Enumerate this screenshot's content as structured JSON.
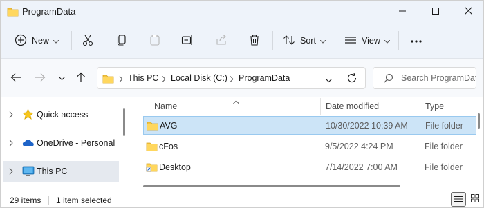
{
  "window": {
    "title": "ProgramData"
  },
  "toolbar": {
    "new_label": "New",
    "sort_label": "Sort",
    "view_label": "View",
    "more_label": "···"
  },
  "address": {
    "crumbs": [
      "This PC",
      "Local Disk (C:)",
      "ProgramData"
    ]
  },
  "search": {
    "placeholder": "Search ProgramData"
  },
  "nav": {
    "items": [
      {
        "label": "Quick access",
        "icon": "star-icon"
      },
      {
        "label": "OneDrive - Personal",
        "icon": "cloud-icon"
      },
      {
        "label": "This PC",
        "icon": "monitor-icon",
        "selected": true
      }
    ]
  },
  "columns": {
    "name": "Name",
    "date": "Date modified",
    "type": "Type"
  },
  "files": [
    {
      "name": "AVG",
      "date": "10/30/2022 10:39 AM",
      "type": "File folder",
      "selected": true
    },
    {
      "name": "cFos",
      "date": "9/5/2022 4:24 PM",
      "type": "File folder"
    },
    {
      "name": "Desktop",
      "date": "7/14/2022 7:00 AM",
      "type": "File folder"
    }
  ],
  "status": {
    "item_count": "29 items",
    "selection": "1 item selected"
  },
  "colors": {
    "accent": "#0067c0",
    "folder": "#f4c542",
    "selection_bg": "#cce4f7",
    "chrome_bg": "#eef3fa"
  }
}
